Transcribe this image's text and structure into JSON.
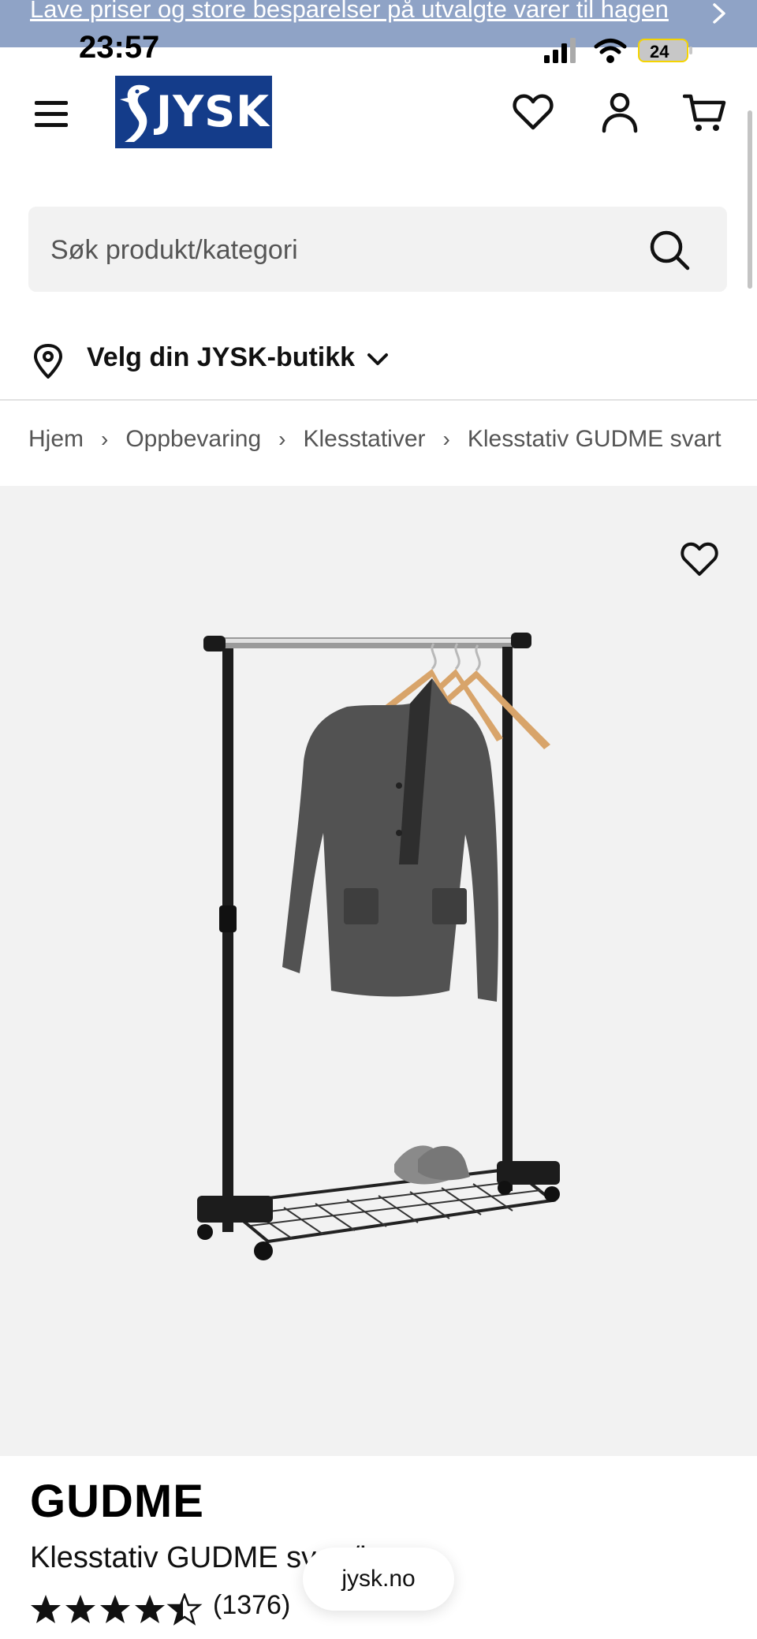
{
  "promo_banner": {
    "text": "Lave priser og store besparelser på utvalgte varer til hagen"
  },
  "status_bar": {
    "time": "23:57",
    "battery": "24"
  },
  "header": {
    "logo_text": "JYSK"
  },
  "search": {
    "placeholder": "Søk produkt/kategori"
  },
  "store_selector": {
    "label": "Velg din JYSK-butikk"
  },
  "breadcrumb": {
    "items": [
      "Hjem",
      "Oppbevaring",
      "Klesstativer",
      "Klesstativ GUDME svart"
    ],
    "separator": "›"
  },
  "product": {
    "brand": "GUDME",
    "name": "Klesstativ GUDME svart/krom",
    "rating": 4.5,
    "rating_max": 5,
    "review_count": "(1376)"
  },
  "browser": {
    "url": "jysk.no"
  },
  "colors": {
    "brand_blue": "#143c8a",
    "promo_bg": "#8fa3c6",
    "image_bg": "#f2f2f2"
  }
}
